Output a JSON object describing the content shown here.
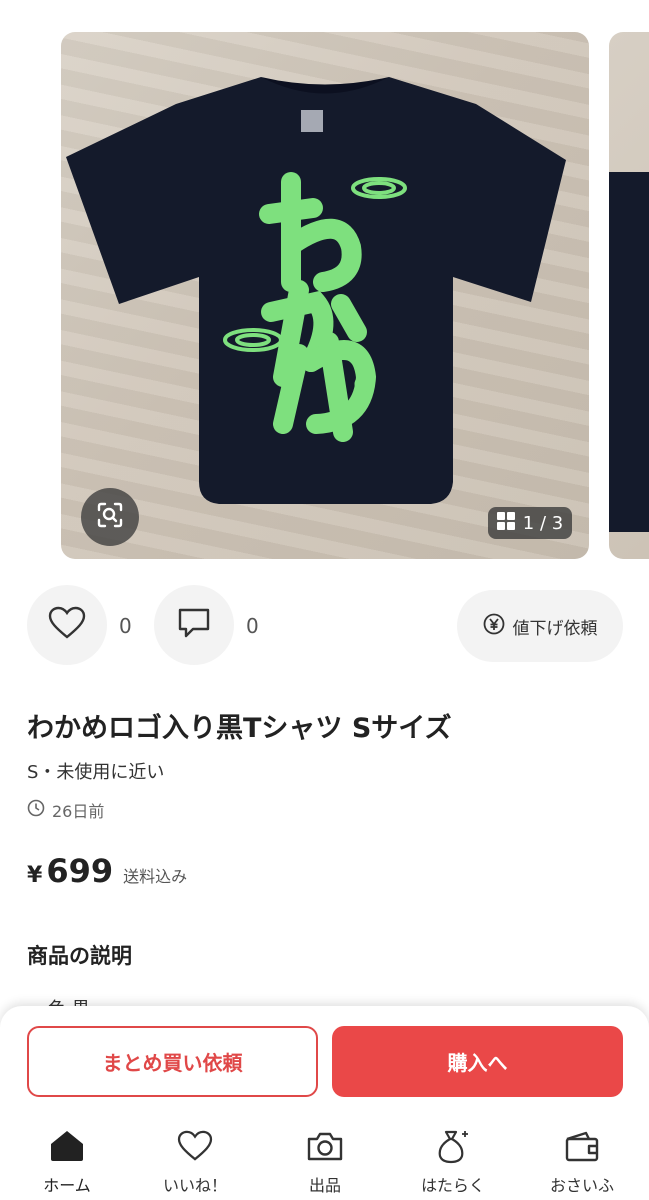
{
  "gallery": {
    "counter_current": "1",
    "counter_total": "3",
    "counter_sep": "/"
  },
  "actions": {
    "like_count": "0",
    "comment_count": "0",
    "price_down_label": "値下げ依頼"
  },
  "item": {
    "title": "わかめロゴ入り黒Tシャツ Sサイズ",
    "condition": "S・未使用に近い",
    "posted": "26日前",
    "currency": "¥",
    "price": "699",
    "shipping": "送料込み",
    "description_heading": "商品の説明",
    "description_peek": "色  黒"
  },
  "buttons": {
    "bulk_request": "まとめ買い依頼",
    "purchase": "購入へ"
  },
  "tabs": [
    {
      "label": "ホーム",
      "icon": "home-icon",
      "active": true
    },
    {
      "label": "いいね！",
      "icon": "heart-icon",
      "active": false
    },
    {
      "label": "出品",
      "icon": "camera-icon",
      "active": false
    },
    {
      "label": "はたらく",
      "icon": "money-bag-icon",
      "active": false
    },
    {
      "label": "おさいふ",
      "icon": "wallet-icon",
      "active": false
    }
  ],
  "colors": {
    "accent": "#ea4848",
    "shirt": "#141a2b",
    "print": "#7ee07e"
  }
}
